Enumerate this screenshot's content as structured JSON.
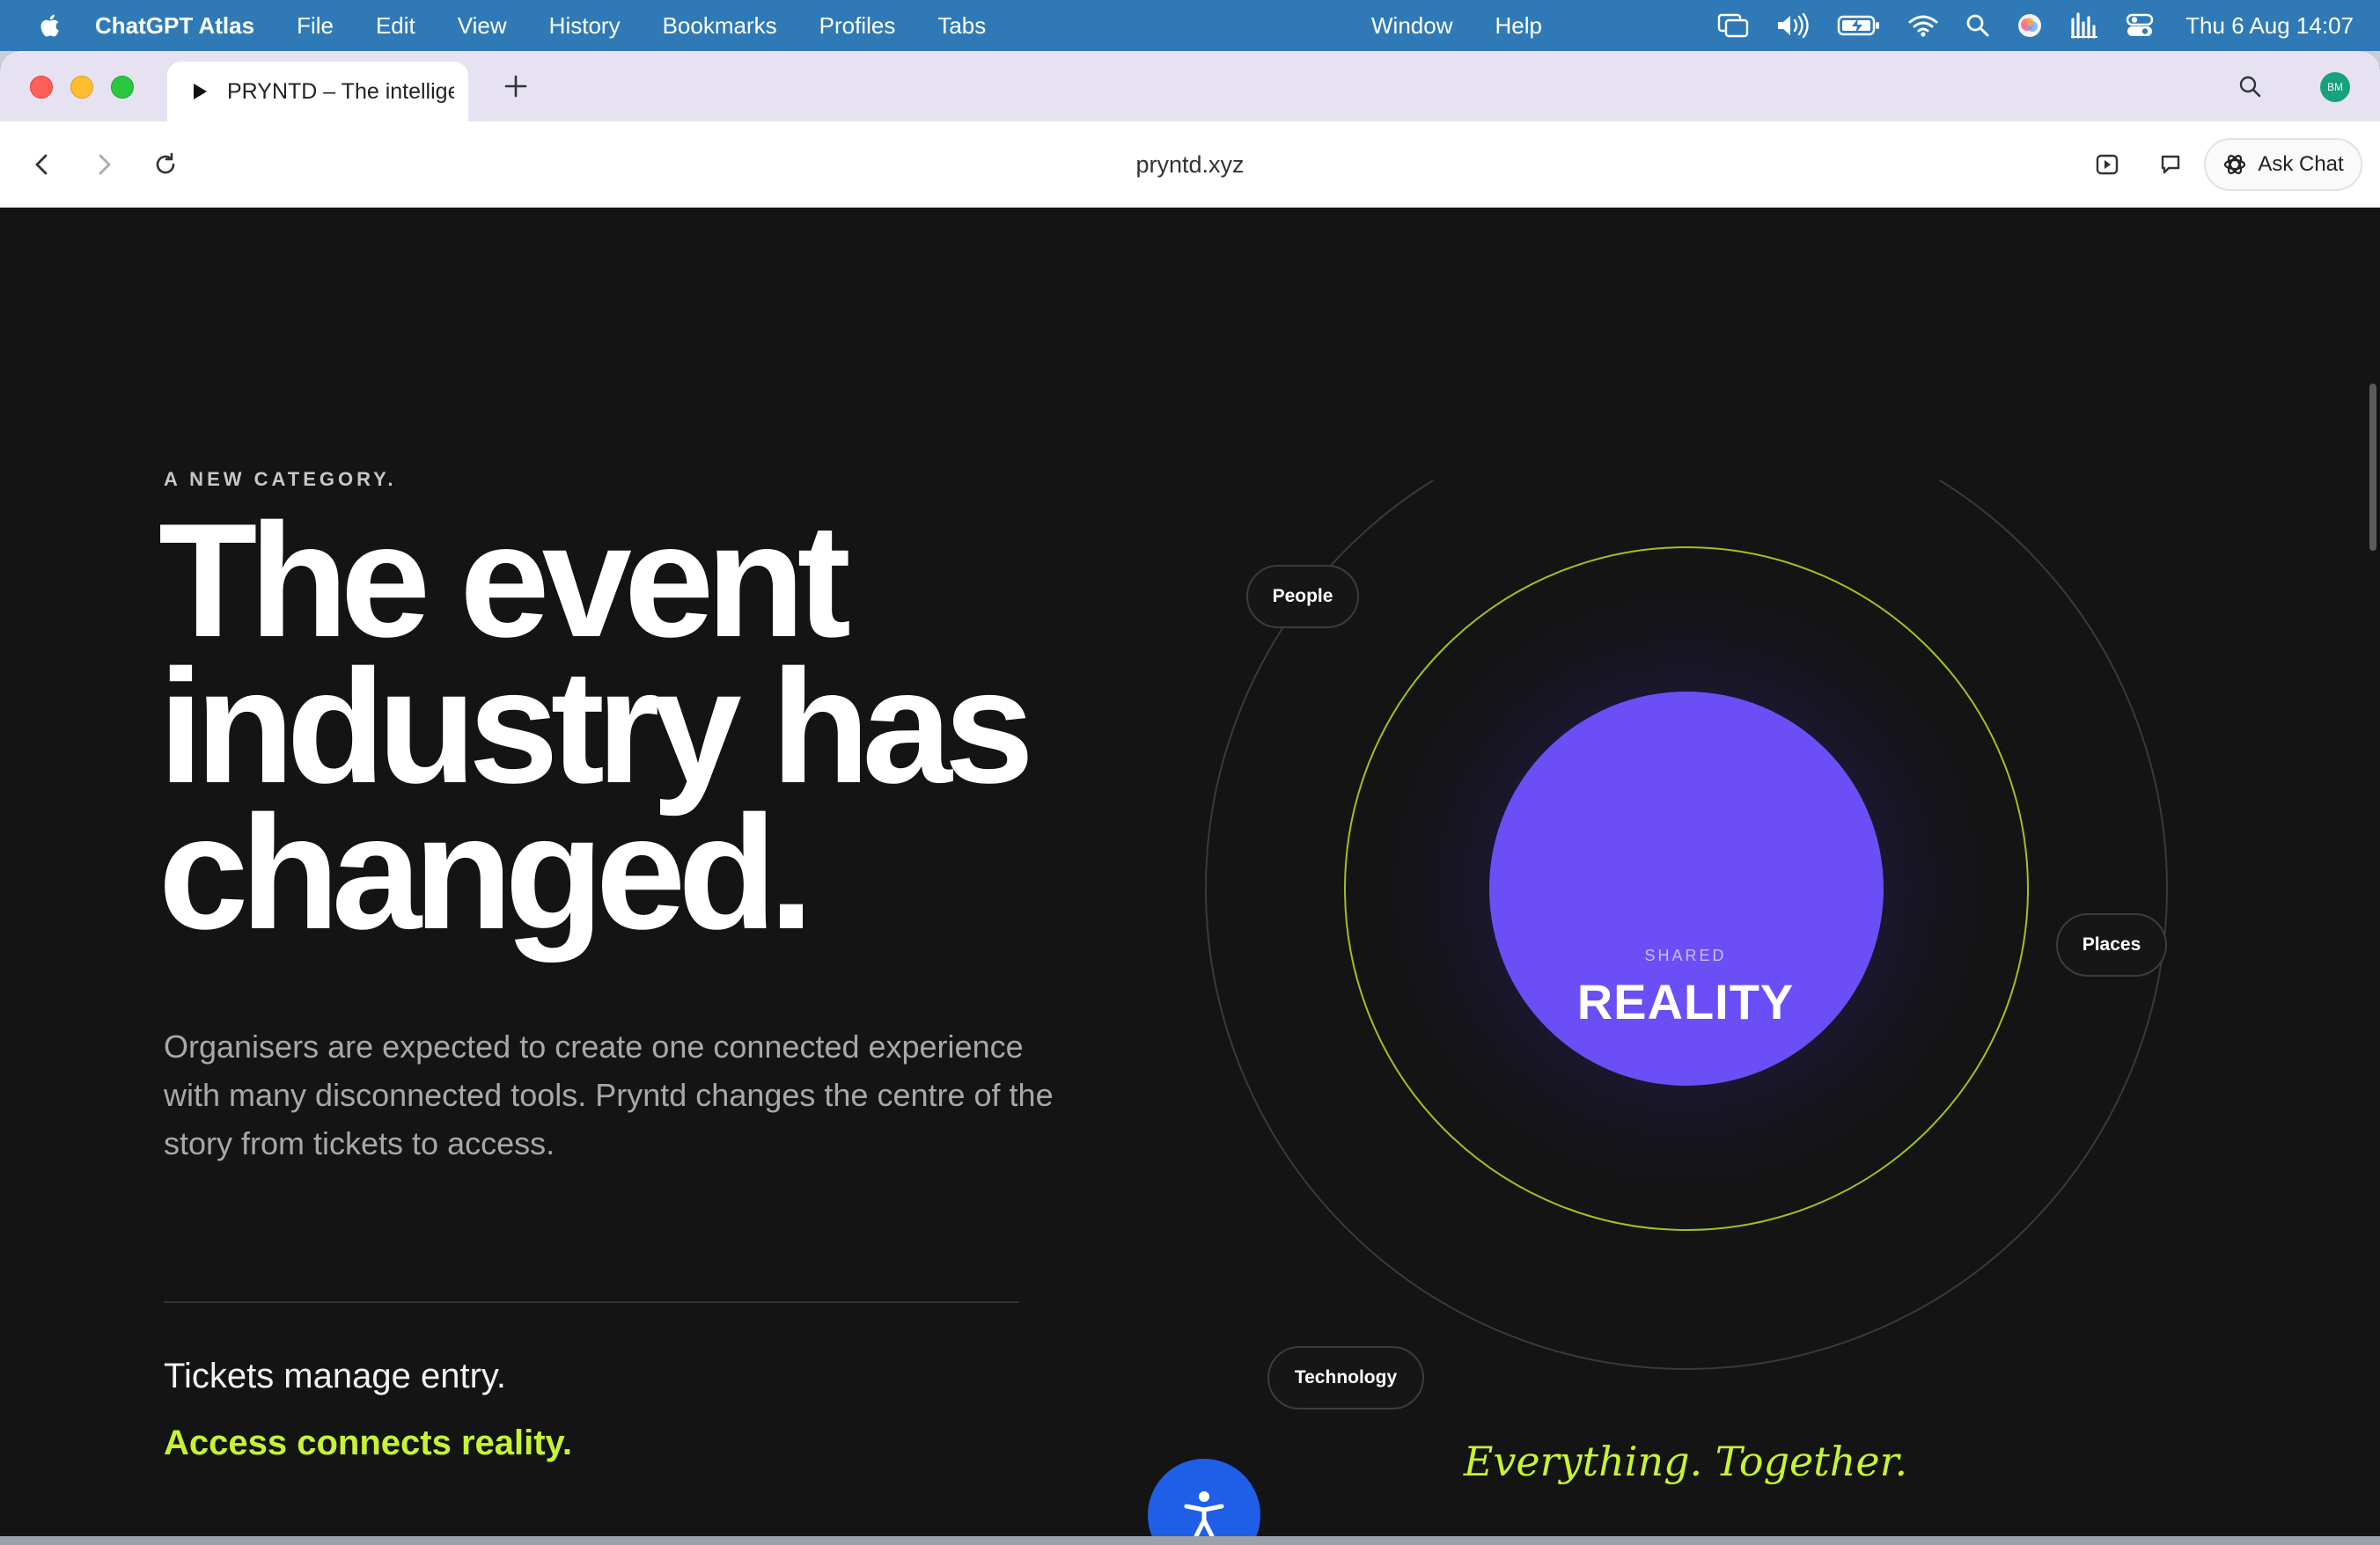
{
  "menubar": {
    "app_name": "ChatGPT Atlas",
    "menus": [
      "File",
      "Edit",
      "View",
      "History",
      "Bookmarks",
      "Profiles",
      "Tabs"
    ],
    "right_menus": [
      "Window",
      "Help"
    ],
    "clock": "Thu 6 Aug  14:07"
  },
  "browser": {
    "tab_title": "PRYNTD – The intelligent",
    "url": "pryntd.xyz",
    "ask_chat_label": "Ask Chat",
    "profile_initials": "BM"
  },
  "hero": {
    "eyebrow": "A NEW CATEGORY.",
    "headline_lines": [
      "The event",
      "industry has",
      "changed."
    ],
    "subcopy": "Organisers are expected to create one connected experience with many disconnected tools. Pryntd changes the centre of the story from tickets to access.",
    "tickets_line": "Tickets manage entry.",
    "access_line": "Access connects reality."
  },
  "diagram": {
    "nodes": [
      "People",
      "Places",
      "Technology"
    ],
    "core_small": "SHARED",
    "core_big": "REALITY",
    "tagline": "Everything. Together.",
    "colors": {
      "core": "#6c4ef6",
      "inner_ring": "#9cc420",
      "outer_ring": "#3a3a3a",
      "accent": "#c6f432"
    }
  },
  "icons": {
    "menubar_status": [
      "screen-mirroring-icon",
      "volume-icon",
      "battery-icon",
      "wifi-icon",
      "spotlight-icon",
      "siri-icon",
      "audio-meter-icon",
      "control-center-icon"
    ],
    "toolbar": [
      "back-icon",
      "forward-icon",
      "reload-icon",
      "reader-icon",
      "sidebar-chat-icon",
      "openai-logo-icon"
    ],
    "floating": "accessibility-icon"
  }
}
